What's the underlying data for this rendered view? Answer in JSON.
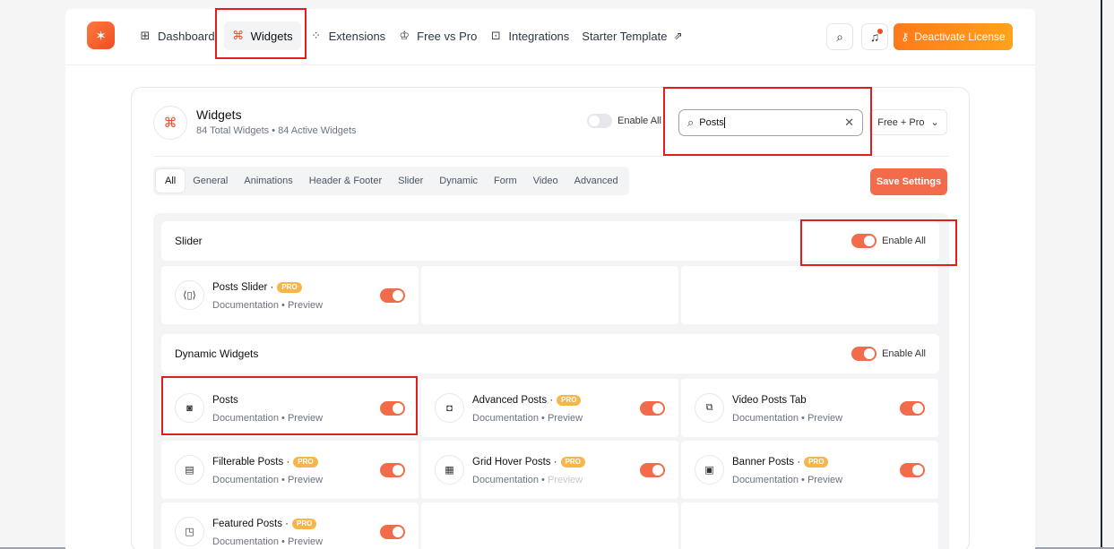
{
  "nav": {
    "items": [
      {
        "label": "Dashboard",
        "icon": "dashboard-icon"
      },
      {
        "label": "Widgets",
        "icon": "command-icon",
        "active": true
      },
      {
        "label": "Extensions",
        "icon": "extensions-icon"
      },
      {
        "label": "Free vs Pro",
        "icon": "crown-icon"
      },
      {
        "label": "Integrations",
        "icon": "puzzle-icon"
      },
      {
        "label": "Starter Template",
        "icon": "external-link-icon"
      }
    ],
    "deactivate_label": "Deactivate License"
  },
  "header": {
    "title": "Widgets",
    "subtitle": "84 Total Widgets • 84 Active Widgets",
    "enable_all_label": "Enable All",
    "search_value": "Posts",
    "filter_label": "Free + Pro",
    "save_label": "Save Settings"
  },
  "tabs": [
    "All",
    "General",
    "Animations",
    "Header & Footer",
    "Slider",
    "Dynamic",
    "Form",
    "Video",
    "Advanced"
  ],
  "sections": {
    "slider": {
      "title": "Slider",
      "enable_all_label": "Enable All",
      "widgets": [
        {
          "name": "Posts Slider ·",
          "pro": "PRO",
          "doc": "Documentation",
          "preview": "Preview",
          "enabled": true
        }
      ]
    },
    "dynamic": {
      "title": "Dynamic Widgets",
      "enable_all_label": "Enable All",
      "widgets": [
        {
          "name": "Posts",
          "pro": "",
          "doc": "Documentation",
          "preview": "Preview",
          "enabled": true
        },
        {
          "name": "Advanced Posts ·",
          "pro": "PRO",
          "doc": "Documentation",
          "preview": "Preview",
          "enabled": true
        },
        {
          "name": "Video Posts Tab",
          "pro": "",
          "doc": "Documentation",
          "preview": "Preview",
          "enabled": true
        },
        {
          "name": "Filterable Posts ·",
          "pro": "PRO",
          "doc": "Documentation",
          "preview": "Preview",
          "enabled": true
        },
        {
          "name": "Grid Hover Posts ·",
          "pro": "PRO",
          "doc": "Documentation",
          "preview": "Preview",
          "enabled": true
        },
        {
          "name": "Banner Posts ·",
          "pro": "PRO",
          "doc": "Documentation",
          "preview": "Preview",
          "enabled": true
        },
        {
          "name": "Featured Posts ·",
          "pro": "PRO",
          "doc": "Documentation",
          "preview": "Preview",
          "enabled": true
        }
      ]
    }
  },
  "colors": {
    "accent": "#f26b4a",
    "pro_badge": "#f8b54c",
    "highlight": "#e11d1d"
  }
}
